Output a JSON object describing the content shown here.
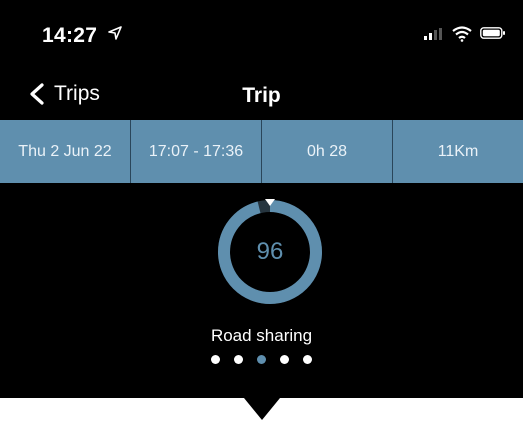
{
  "status_bar": {
    "time": "14:27"
  },
  "nav": {
    "back_label": "Trips",
    "title": "Trip"
  },
  "summary": [
    "Thu 2 Jun 22",
    "17:07 - 17:36",
    "0h 28",
    "11Km"
  ],
  "score": {
    "value": "96",
    "label": "Road sharing",
    "fraction": 0.96
  },
  "pager": {
    "count": 5,
    "active_index": 2
  },
  "colors": {
    "accent": "#5f8fae",
    "background": "#000000"
  }
}
